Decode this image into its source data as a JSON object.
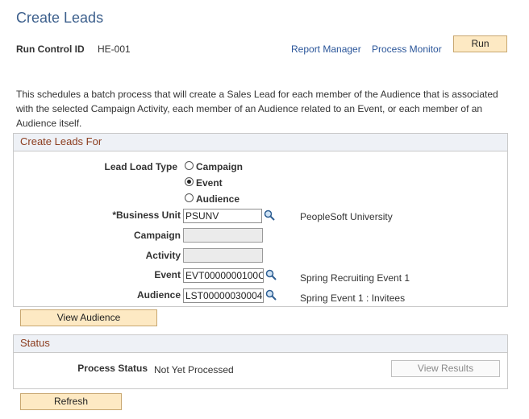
{
  "page": {
    "title": "Create Leads"
  },
  "run_control": {
    "label": "Run Control ID",
    "value": "HE-001",
    "report_manager": "Report Manager",
    "process_monitor": "Process Monitor",
    "run_label": "Run"
  },
  "description": "This schedules a batch process that will create a Sales Lead for each member of the Audience that is associated with the selected Campaign Activity, each member of an Audience related to an Event, or each member of an Audience itself.",
  "create_leads": {
    "header": "Create Leads For",
    "lead_load_type_label": "Lead Load Type",
    "options": [
      {
        "label": "Campaign",
        "selected": false
      },
      {
        "label": "Event",
        "selected": true
      },
      {
        "label": "Audience",
        "selected": false
      }
    ],
    "business_unit": {
      "label": "*Business Unit",
      "value": "PSUNV",
      "description": "PeopleSoft University"
    },
    "campaign": {
      "label": "Campaign",
      "value": ""
    },
    "activity": {
      "label": "Activity",
      "value": ""
    },
    "event": {
      "label": "Event",
      "value": "EVT0000000100C",
      "description": "Spring Recruiting Event 1"
    },
    "audience": {
      "label": "Audience",
      "value": "LST00000030004",
      "description": "Spring Event 1 : Invitees"
    },
    "view_audience_label": "View Audience"
  },
  "status": {
    "header": "Status",
    "process_status_label": "Process Status",
    "process_status_value": "Not Yet Processed",
    "view_results_label": "View Results",
    "refresh_label": "Refresh"
  },
  "colors": {
    "title": "#3c5f8c",
    "group_header_text": "#8b3c1e",
    "button_bg": "#fde9c3",
    "link": "#2a5599"
  },
  "icons": {
    "lookup": "magnifier-lookup-icon",
    "radio": "radio-button"
  }
}
